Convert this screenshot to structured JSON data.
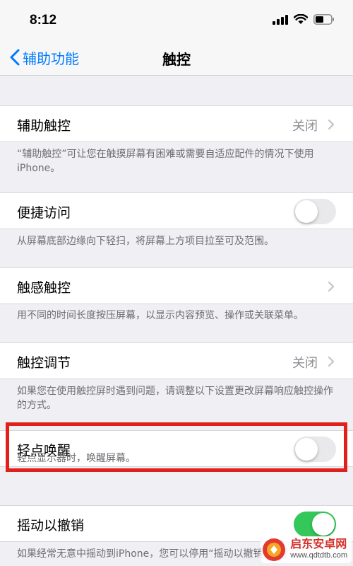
{
  "status_bar": {
    "time": "8:12"
  },
  "nav": {
    "back_label": "辅助功能",
    "title": "触控"
  },
  "rows": [
    {
      "label": "辅助触控",
      "value": "关闭",
      "footer": "“辅助触控”可让您在触摸屏幕有困难或需要自适应配件的情况下使用iPhone。"
    },
    {
      "label": "便捷访问",
      "toggle": "off",
      "footer": "从屏幕底部边缘向下轻扫，将屏幕上方项目拉至可及范围。"
    },
    {
      "label": "触感触控",
      "footer": "用不同的时间长度按压屏幕，以显示内容预览、操作或关联菜单。"
    },
    {
      "label": "触控调节",
      "value": "关闭",
      "footer": "如果您在使用触控屏时遇到问题，请调整以下设置更改屏幕响应触控操作的方式。"
    },
    {
      "label": "轻点唤醒",
      "toggle": "off",
      "footer": "轻点显示器时，唤醒屏幕。"
    },
    {
      "label": "摇动以撤销",
      "toggle": "on",
      "footer": "如果经常无意中摇动到iPhone，您可以停用“摇动以撤销”提醒"
    }
  ],
  "watermark": {
    "title": "启东安卓网",
    "url": "www.qdtdtb.com"
  },
  "colors": {
    "accent": "#007aff",
    "toggle_on": "#34c759",
    "highlight": "#e0201b"
  }
}
